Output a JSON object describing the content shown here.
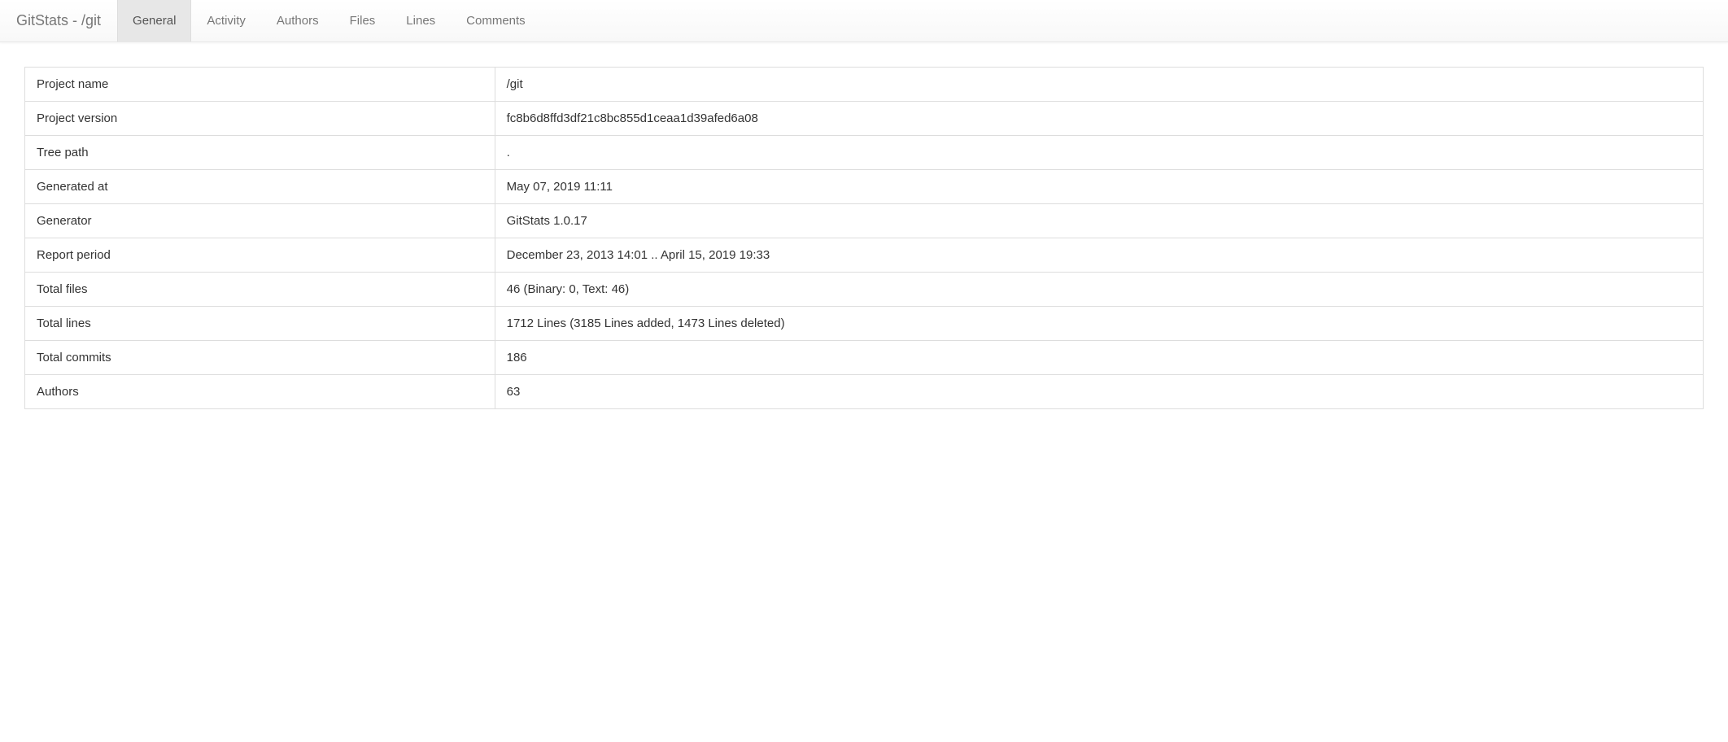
{
  "navbar": {
    "brand": "GitStats - /git",
    "tabs": [
      {
        "label": "General",
        "active": true
      },
      {
        "label": "Activity",
        "active": false
      },
      {
        "label": "Authors",
        "active": false
      },
      {
        "label": "Files",
        "active": false
      },
      {
        "label": "Lines",
        "active": false
      },
      {
        "label": "Comments",
        "active": false
      }
    ]
  },
  "general": {
    "rows": [
      {
        "key": "Project name",
        "value": "/git"
      },
      {
        "key": "Project version",
        "value": "fc8b6d8ffd3df21c8bc855d1ceaa1d39afed6a08"
      },
      {
        "key": "Tree path",
        "value": "."
      },
      {
        "key": "Generated at",
        "value": "May 07, 2019 11:11"
      },
      {
        "key": "Generator",
        "value": "GitStats 1.0.17"
      },
      {
        "key": "Report period",
        "value": "December 23, 2013 14:01 .. April 15, 2019 19:33"
      },
      {
        "key": "Total files",
        "value": "46 (Binary: 0, Text: 46)"
      },
      {
        "key": "Total lines",
        "value": "1712 Lines (3185 Lines added, 1473 Lines deleted)"
      },
      {
        "key": "Total commits",
        "value": "186"
      },
      {
        "key": "Authors",
        "value": "63"
      }
    ]
  }
}
